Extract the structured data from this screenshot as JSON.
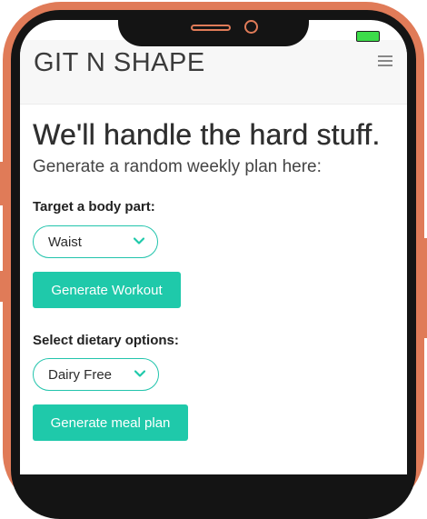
{
  "brand": {
    "title": "GIT N SHAPE"
  },
  "hero": {
    "headline": "We'll handle the hard stuff.",
    "subheadline": "Generate a random weekly plan here:"
  },
  "workout": {
    "label": "Target a body part:",
    "selected": "Waist",
    "button_label": "Generate Workout"
  },
  "diet": {
    "label": "Select dietary options:",
    "selected": "Dairy Free",
    "button_label": "Generate meal plan"
  },
  "icons": {
    "menu": "hamburger-icon",
    "dropdown": "chevron-down-icon",
    "battery": "battery-icon"
  },
  "colors": {
    "accent": "#1fc9aa",
    "frame": "#e07b58",
    "text": "#2f2f2f"
  }
}
